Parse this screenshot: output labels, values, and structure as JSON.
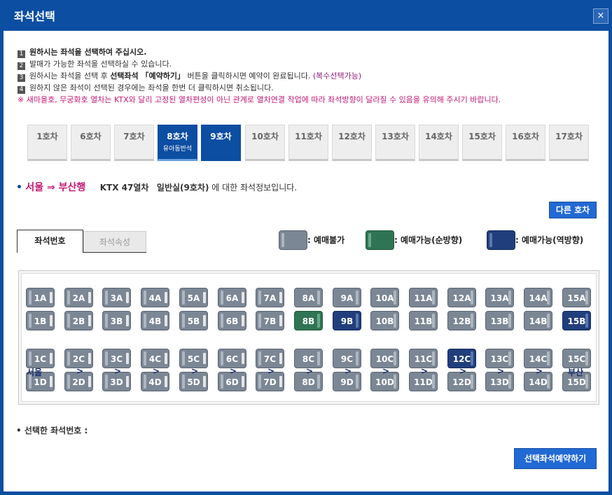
{
  "window": {
    "title": "좌석선택",
    "close_label": "×"
  },
  "notice": {
    "lines": [
      {
        "num": "1",
        "text": "원하시는 좌석을 선택하여 주십시오."
      },
      {
        "num": "2",
        "text": "발매가 가능한 좌석을 선택하실 수 있습니다."
      },
      {
        "num": "3",
        "pre": "원하시는 좌석을 선택 후 ",
        "bold": "선택좌석 「예약하기」",
        "post": " 버튼을 클릭하시면 예약이 완료됩니다. ",
        "purple": "(복수선택가능)"
      },
      {
        "num": "4",
        "text": "원하지 않은 좌석이 선택된 경우에는 좌석을 한번 더 클릭하시면 취소됩니다."
      }
    ],
    "warning": "※ 새마을호, 무궁화호 열차는 KTX와 달리 고정된 열차편성이 아닌 관계로 열차연결 작업에 따라 좌석방향이 달라질 수 있음을 유의해 주시기 바랍니다."
  },
  "cars": [
    {
      "label": "1호차",
      "sub": ""
    },
    {
      "label": "6호차",
      "sub": ""
    },
    {
      "label": "7호차",
      "sub": ""
    },
    {
      "label": "8호차",
      "sub": "유아동반석",
      "state": "active"
    },
    {
      "label": "9호차",
      "sub": "",
      "state": "selected"
    },
    {
      "label": "10호차",
      "sub": ""
    },
    {
      "label": "11호차",
      "sub": ""
    },
    {
      "label": "12호차",
      "sub": ""
    },
    {
      "label": "13호차",
      "sub": ""
    },
    {
      "label": "14호차",
      "sub": ""
    },
    {
      "label": "15호차",
      "sub": ""
    },
    {
      "label": "16호차",
      "sub": ""
    },
    {
      "label": "17호차",
      "sub": ""
    }
  ],
  "route": {
    "bullet": "•",
    "text": "서울 ⇒ 부산행",
    "train": "KTX 47열차",
    "class": "일반실(9호차)",
    "suffix": "에 대한 좌석정보입니다."
  },
  "other_car_label": "다른 호차",
  "tabs": [
    {
      "label": "좌석번호",
      "active": true
    },
    {
      "label": "좌석속성",
      "active": false
    }
  ],
  "legend": [
    {
      "label": ": 예매불가",
      "color": "#7c8795"
    },
    {
      "label": ": 예매가능(순방향)",
      "color": "#2f7454"
    },
    {
      "label": ": 예매가능(역방향)",
      "color": "#203e7c"
    }
  ],
  "seatmap": {
    "rows": [
      "A",
      "B",
      "C",
      "D"
    ],
    "columns": [
      1,
      2,
      3,
      4,
      5,
      6,
      7,
      8,
      9,
      10,
      11,
      12,
      13,
      14,
      15
    ],
    "forward_columns": [
      8,
      9,
      10,
      11,
      12,
      13,
      14,
      15
    ],
    "available_forward": [
      "8B"
    ],
    "available_reverse": [
      "9B",
      "15B",
      "12C"
    ],
    "aisle_start": "서울",
    "aisle_end": "부산",
    "aisle_arrow": ">"
  },
  "selected_label": "• 선택한 좌석번호 :",
  "reserve_label": "선택좌석예약하기"
}
